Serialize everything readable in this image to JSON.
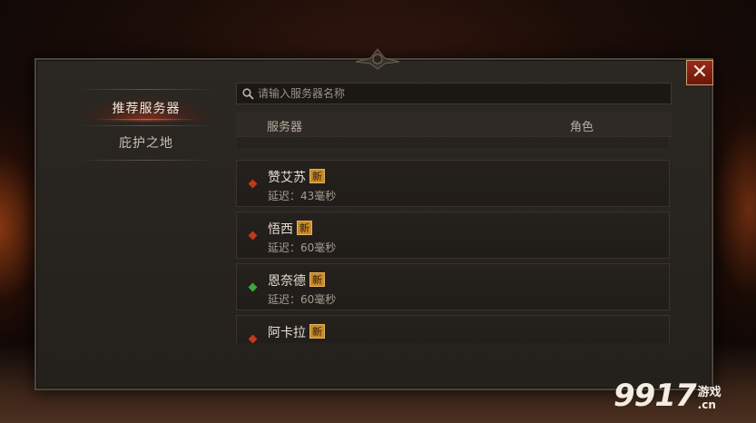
{
  "menu": {
    "items": [
      {
        "label": "推荐服务器",
        "active": true
      },
      {
        "label": "庇护之地",
        "active": false
      }
    ]
  },
  "search": {
    "placeholder": "请输入服务器名称"
  },
  "list": {
    "header": {
      "server": "服务器",
      "role": "角色"
    },
    "rows": [
      {
        "name": "",
        "latency": "",
        "visible": "partial-top"
      },
      {
        "name": "赞艾苏",
        "badge": "新",
        "latency": "延迟：43毫秒",
        "status_color": "#c0391b"
      },
      {
        "name": "悟西",
        "badge": "新",
        "latency": "延迟：60毫秒",
        "status_color": "#c0391b"
      },
      {
        "name": "恩奈德",
        "badge": "新",
        "latency": "延迟：60毫秒",
        "status_color": "#3fa83a"
      },
      {
        "name": "阿卡拉",
        "badge": "新",
        "latency": "",
        "status_color": "#c0391b",
        "visible": "partial-bottom"
      }
    ]
  },
  "close_label": "✕",
  "watermark": {
    "number": "9917",
    "game": "游戏",
    "domain": ".cn"
  },
  "colors": {
    "accent_red": "#9a2a1a",
    "badge_gold": "#c98a2a",
    "status_red": "#c0391b",
    "status_green": "#3fa83a"
  }
}
